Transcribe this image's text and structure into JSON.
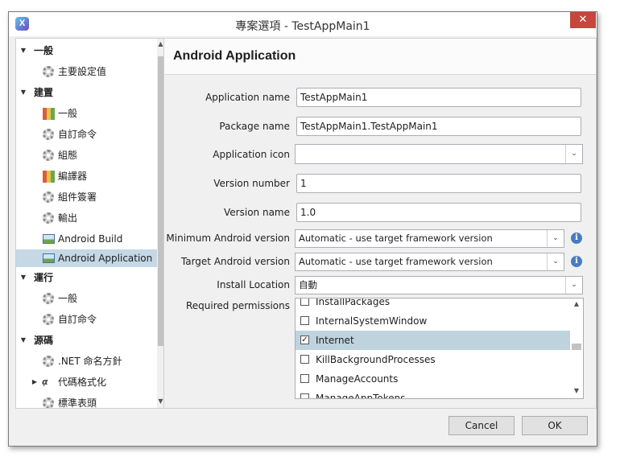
{
  "window": {
    "title": "專案選項 - TestAppMain1",
    "close_glyph": "✕",
    "app_icon_glyph": "X"
  },
  "sidebar": {
    "categories": [
      {
        "label": "一般",
        "items": [
          {
            "label": "主要設定值",
            "icon": "gear-icon"
          }
        ]
      },
      {
        "label": "建置",
        "items": [
          {
            "label": "一般",
            "icon": "build-icon"
          },
          {
            "label": "自訂命令",
            "icon": "gear-icon"
          },
          {
            "label": "組態",
            "icon": "gear-icon"
          },
          {
            "label": "編譯器",
            "icon": "build-icon"
          },
          {
            "label": "組件簽署",
            "icon": "gear-icon"
          },
          {
            "label": "輸出",
            "icon": "gear-icon"
          },
          {
            "label": "Android Build",
            "icon": "image-icon"
          },
          {
            "label": "Android Application",
            "icon": "image-icon",
            "selected": true
          }
        ]
      },
      {
        "label": "運行",
        "items": [
          {
            "label": "一般",
            "icon": "gear-icon"
          },
          {
            "label": "自訂命令",
            "icon": "gear-icon"
          }
        ]
      },
      {
        "label": "源碼",
        "items": [
          {
            "label": ".NET 命名方針",
            "icon": "gear-icon"
          },
          {
            "label": "代碼格式化",
            "icon": "format-icon"
          },
          {
            "label": "標準表頭",
            "icon": "gear-icon"
          }
        ]
      }
    ]
  },
  "panel": {
    "title": "Android Application",
    "fields": {
      "app_name": {
        "label": "Application name",
        "value": "TestAppMain1"
      },
      "package_name": {
        "label": "Package name",
        "value": "TestAppMain1.TestAppMain1"
      },
      "app_icon": {
        "label": "Application icon",
        "value": ""
      },
      "version_number": {
        "label": "Version number",
        "value": "1"
      },
      "version_name": {
        "label": "Version name",
        "value": "1.0"
      },
      "min_android": {
        "label": "Minimum Android version",
        "value": "Automatic - use target framework version"
      },
      "target_android": {
        "label": "Target Android version",
        "value": "Automatic - use target framework version"
      },
      "install_location": {
        "label": "Install Location",
        "value": "自動"
      },
      "permissions": {
        "label": "Required permissions",
        "items": [
          {
            "label": "InstallPackages",
            "checked": false
          },
          {
            "label": "InternalSystemWindow",
            "checked": false
          },
          {
            "label": "Internet",
            "checked": true,
            "selected": true
          },
          {
            "label": "KillBackgroundProcesses",
            "checked": false
          },
          {
            "label": "ManageAccounts",
            "checked": false
          },
          {
            "label": "ManageAppTokens",
            "checked": false
          }
        ]
      }
    }
  },
  "buttons": {
    "cancel": "Cancel",
    "ok": "OK"
  },
  "glyphs": {
    "expand": "▼",
    "collapsed": "▶",
    "dropdown": "⌄",
    "info": "i",
    "check": "✓",
    "scroll_up": "▲",
    "scroll_down": "▼"
  }
}
